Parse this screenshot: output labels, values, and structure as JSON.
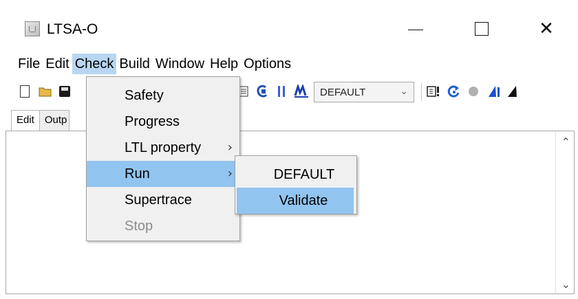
{
  "window": {
    "title": "LTSA-O",
    "controls": {
      "minimize": "minimize",
      "maximize": "maximize",
      "close": "✕"
    }
  },
  "menubar": {
    "items": [
      "File",
      "Edit",
      "Check",
      "Build",
      "Window",
      "Help",
      "Options"
    ],
    "active": "Check"
  },
  "toolbar": {
    "icons": [
      "new-file-icon",
      "open-folder-icon",
      "save-icon",
      "compile-icon",
      "compose-icon",
      "parallel-icon",
      "minimise-icon",
      "draw-icon",
      "refresh-icon",
      "stop-icon",
      "animate-blue-icon",
      "animate-black-icon"
    ],
    "target_select": {
      "value": "DEFAULT"
    }
  },
  "tabs": [
    {
      "label": "Edit"
    },
    {
      "label": "Outp"
    }
  ],
  "check_menu": {
    "items": [
      {
        "label": "Safety"
      },
      {
        "label": "Progress"
      },
      {
        "label": "LTL property",
        "submenu": true
      },
      {
        "label": "Run",
        "submenu": true,
        "highlighted": true
      },
      {
        "label": "Supertrace"
      },
      {
        "label": "Stop",
        "disabled": true
      }
    ]
  },
  "run_submenu": {
    "items": [
      {
        "label": "DEFAULT"
      },
      {
        "label": "Validate",
        "highlighted": true
      }
    ]
  },
  "colors": {
    "menu_highlight": "#91c4ef",
    "menubar_active": "#b8d6f2",
    "menu_background": "#f0f0f0",
    "disabled_text": "#8c8c8c"
  }
}
